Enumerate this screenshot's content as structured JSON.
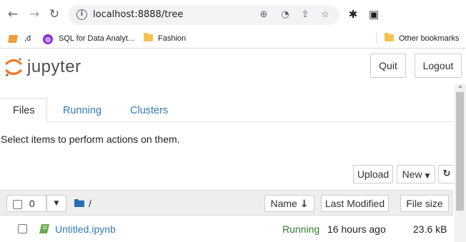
{
  "browser": {
    "url": "localhost:8888/tree",
    "nav_icons": {
      "back": "back-arrow-icon",
      "forward": "forward-arrow-icon",
      "reload": "reload-icon"
    },
    "bookmarks": [
      {
        "label": ",d"
      },
      {
        "label": "SQL for Data Analyt..."
      },
      {
        "label": "Fashion"
      }
    ],
    "other_bookmarks": "Other bookmarks"
  },
  "jupyter": {
    "logo_text": "jupyter",
    "buttons": {
      "quit": "Quit",
      "logout": "Logout"
    },
    "tabs": [
      {
        "label": "Files",
        "active": true
      },
      {
        "label": "Running",
        "active": false
      },
      {
        "label": "Clusters",
        "active": false
      }
    ],
    "info_text": "Select items to perform actions on them.",
    "actions": {
      "upload": "Upload",
      "new": "New"
    },
    "list_header": {
      "selected_count": "0",
      "path": "/",
      "name": "Name",
      "last_modified": "Last Modified",
      "file_size": "File size"
    },
    "files": [
      {
        "name": "Untitled.ipynb",
        "status": "Running",
        "modified": "16 hours ago",
        "size": "23.6 kB"
      }
    ]
  },
  "colors": {
    "link": "#337ab7",
    "running": "#2e7d32",
    "notebook_icon": "#6aa84f",
    "folder_icon": "#2a6db5",
    "logo_orange": "#f37726"
  }
}
